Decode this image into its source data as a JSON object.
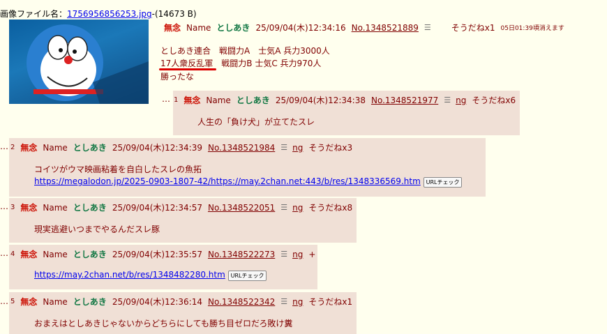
{
  "op": {
    "file_label": "画像ファイル名：",
    "file_name": "1756956856253.jpg",
    "file_size": "-(14673 B)",
    "subject": "無念",
    "name_label": "Name",
    "name": "としあき",
    "datetime": "25/09/04(木)12:34:16",
    "number": "No.1348521889",
    "menu": "☰",
    "sodane": "そうだねx1",
    "expire": "05日01:39頃消えます",
    "lines": [
      "としあき連合　戦闘力A　士気A 兵力3000人",
      "17人衆反乱軍　戦闘力B 士気C 兵力970人",
      "勝ったな"
    ]
  },
  "replies": [
    {
      "idx": "1",
      "subject": "無念",
      "name_label": "Name",
      "name": "としあき",
      "datetime": "25/09/04(木)12:34:38",
      "number": "No.1348521977",
      "ng": "ng",
      "sodane": "そうだねx6",
      "body": "人生の「負け犬」が立てたスレ"
    },
    {
      "idx": "2",
      "subject": "無念",
      "name_label": "Name",
      "name": "としあき",
      "datetime": "25/09/04(木)12:34:39",
      "number": "No.1348521984",
      "ng": "ng",
      "sodane": "そうだねx3",
      "body": "コイツがウマ映画粘着を自白したスレの魚拓",
      "link": "https://megalodon.jp/2025-0903-1807-42/https://may.2chan.net:443/b/res/1348336569.htm",
      "check": "URLチェック"
    },
    {
      "idx": "3",
      "subject": "無念",
      "name_label": "Name",
      "name": "としあき",
      "datetime": "25/09/04(木)12:34:57",
      "number": "No.1348522051",
      "ng": "ng",
      "sodane": "そうだねx8",
      "body": "現実逃避いつまでやるんだスレ豚"
    },
    {
      "idx": "4",
      "subject": "無念",
      "name_label": "Name",
      "name": "としあき",
      "datetime": "25/09/04(木)12:35:57",
      "number": "No.1348522273",
      "ng": "ng",
      "sodane": "+",
      "link": "https://may.2chan.net/b/res/1348482280.htm",
      "check": "URLチェック"
    },
    {
      "idx": "5",
      "subject": "無念",
      "name_label": "Name",
      "name": "としあき",
      "datetime": "25/09/04(木)12:36:14",
      "number": "No.1348522342",
      "ng": "ng",
      "sodane": "そうだねx1",
      "body": "おまえはとしあきじゃないからどちらにしても勝ち目ゼロだろ敗け糞"
    }
  ],
  "dots": "…",
  "colors": {
    "bg": "#ffffee",
    "reply_bg": "#f0e0d6",
    "subject": "#cc1105",
    "name": "#117743",
    "text": "#800000",
    "link": "#0000ee",
    "underline": "#dd0000"
  }
}
